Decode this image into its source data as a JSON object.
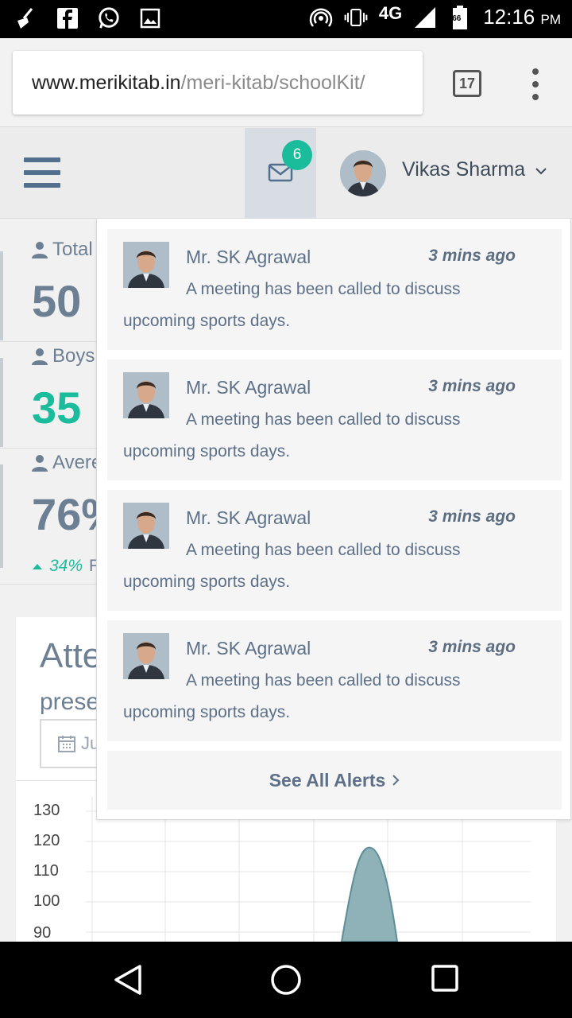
{
  "status_bar": {
    "left_icons": [
      "broom-icon",
      "facebook-icon",
      "whatsapp-icon",
      "gallery-icon"
    ],
    "right_icons": [
      "hotspot-icon",
      "vibrate-icon",
      "signal-icon",
      "battery-icon"
    ],
    "network": "4G",
    "battery_level": "66",
    "time": "12:16",
    "ampm": "PM"
  },
  "browser": {
    "url_host": "www.merikitab.in",
    "url_path": "/meri-kitab/schoolKit/",
    "tab_count": "17"
  },
  "header": {
    "message_count": "6",
    "user_name": "Vikas Sharma"
  },
  "dashboard": {
    "stats": [
      {
        "label": "Total",
        "value": "50"
      },
      {
        "label": "Boys",
        "value": "35"
      },
      {
        "label": "Avere",
        "value": "76%"
      }
    ],
    "trend_value": "34%",
    "trend_text": "F",
    "attendance_title": "Atte",
    "attendance_subtitle": "prese",
    "date_field": "Ju",
    "y_ticks": [
      "130",
      "120",
      "110",
      "100",
      "90"
    ]
  },
  "chart_data": {
    "type": "area",
    "title": "",
    "xlabel": "",
    "ylabel": "",
    "ylim": [
      90,
      130
    ],
    "yticks": [
      90,
      100,
      110,
      120,
      130
    ],
    "series": [
      {
        "name": "",
        "peak": 118
      }
    ],
    "grid": true,
    "color": "#8fb1b8"
  },
  "alerts": [
    {
      "sender": "Mr. SK Agrawal",
      "time": "3 mins ago",
      "message": "A meeting has been called to discuss upcoming sports days."
    },
    {
      "sender": "Mr. SK Agrawal",
      "time": "3 mins ago",
      "message": "A meeting has been called to discuss upcoming sports days."
    },
    {
      "sender": "Mr. SK Agrawal",
      "time": "3 mins ago",
      "message": "A meeting has been called to discuss upcoming sports days."
    },
    {
      "sender": "Mr. SK Agrawal",
      "time": "3 mins ago",
      "message": "A meeting has been called to discuss upcoming sports days."
    }
  ],
  "see_all_label": "See All Alerts",
  "colors": {
    "accent": "#1abc9c",
    "text": "#5d7088",
    "header_bg": "#ececec"
  }
}
